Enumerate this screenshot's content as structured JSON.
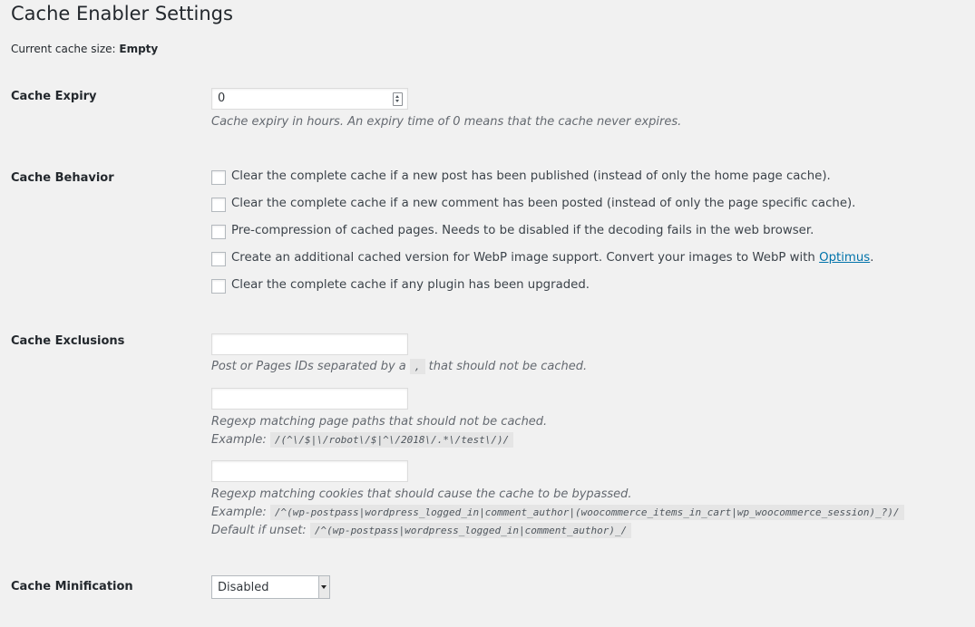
{
  "page": {
    "title": "Cache Enabler Settings"
  },
  "cache_size": {
    "label": "Current cache size:",
    "value": "Empty"
  },
  "expiry": {
    "label": "Cache Expiry",
    "value": "0",
    "description": "Cache expiry in hours. An expiry time of 0 means that the cache never expires."
  },
  "behavior": {
    "label": "Cache Behavior",
    "options": [
      {
        "text": "Clear the complete cache if a new post has been published (instead of only the home page cache).",
        "checked": false
      },
      {
        "text": "Clear the complete cache if a new comment has been posted (instead of only the page specific cache).",
        "checked": false
      },
      {
        "text": "Pre-compression of cached pages. Needs to be disabled if the decoding fails in the web browser.",
        "checked": false
      },
      {
        "text": "Create an additional cached version for WebP image support. Convert your images to WebP with",
        "link": "Optimus",
        "suffix": ".",
        "checked": false
      },
      {
        "text": "Clear the complete cache if any plugin has been upgraded.",
        "checked": false
      }
    ]
  },
  "exclusions": {
    "label": "Cache Exclusions",
    "ids": {
      "value": "",
      "desc_before": "Post or Pages IDs separated by a",
      "separator": ",",
      "desc_after": "that should not be cached."
    },
    "paths": {
      "value": "",
      "desc": "Regexp matching page paths that should not be cached.",
      "example_label": "Example:",
      "example": "/(^\\/$|\\/robot\\/$|^\\/2018\\/.*\\/test\\/)/"
    },
    "cookies": {
      "value": "",
      "desc": "Regexp matching cookies that should cause the cache to be bypassed.",
      "example_label": "Example:",
      "example": "/^(wp-postpass|wordpress_logged_in|comment_author|(woocommerce_items_in_cart|wp_woocommerce_session)_?)/",
      "default_label": "Default if unset:",
      "default": "/^(wp-postpass|wordpress_logged_in|comment_author)_/"
    }
  },
  "minification": {
    "label": "Cache Minification",
    "selected": "Disabled"
  }
}
